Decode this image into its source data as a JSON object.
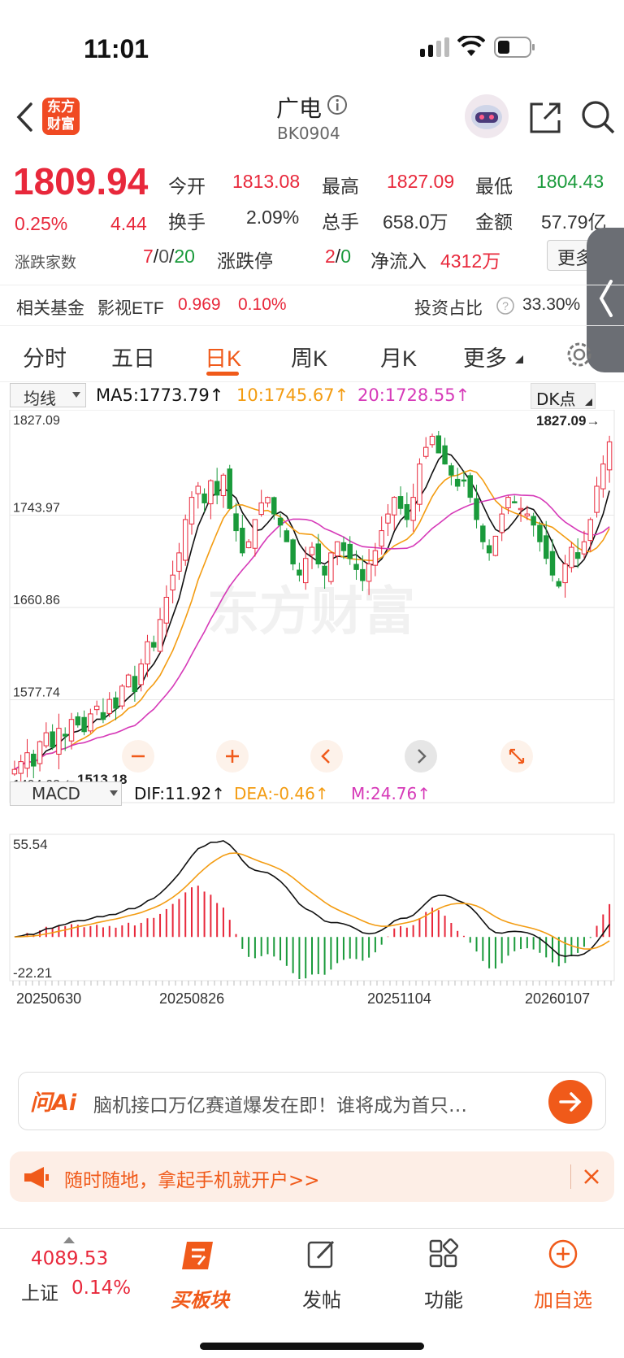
{
  "status": {
    "time": "11:01"
  },
  "header": {
    "logo_line1": "东方",
    "logo_line2": "财富",
    "title": "广电",
    "code": "BK0904"
  },
  "quote": {
    "price": "1809.94",
    "change_pct": "0.25%",
    "change": "4.44",
    "open_label": "今开",
    "open": "1813.08",
    "high_label": "最高",
    "high": "1827.09",
    "low_label": "最低",
    "low": "1804.43",
    "turnover_label": "换手",
    "turnover": "2.09%",
    "volume_label": "总手",
    "volume": "658.0万",
    "amount_label": "金额",
    "amount": "57.79亿",
    "breadth_label": "涨跌家数",
    "up": "7",
    "flat": "0",
    "down": "20",
    "limit_label": "涨跌停",
    "limit_up": "2",
    "limit_down": "0",
    "netflow_label": "净流入",
    "netflow": "4312万",
    "more": "更多"
  },
  "fund": {
    "label": "相关基金",
    "name": "影视ETF",
    "price": "0.969",
    "pct": "0.10%",
    "ratio_label": "投资占比",
    "ratio": "33.30%"
  },
  "tabs": [
    {
      "label": "分时"
    },
    {
      "label": "五日"
    },
    {
      "label": "日K"
    },
    {
      "label": "周K"
    },
    {
      "label": "月K"
    },
    {
      "label": "更多"
    }
  ],
  "chart_controls": {
    "ma_select": "均线",
    "ma5": "MA5:1773.79↑",
    "ma10": "10:1745.67↑",
    "ma20": "20:1728.55↑",
    "dk": "DK点",
    "macd_select": "MACD",
    "dif": "DIF:11.92↑",
    "dea": "DEA:-0.46↑",
    "m": "M:24.76↑",
    "watermark": "东方财富"
  },
  "chart_data": {
    "type": "candlestick",
    "y_ticks": [
      "1827.09",
      "1743.97",
      "1660.86",
      "1577.74",
      "1494.62"
    ],
    "ylim": [
      1494.62,
      1827.09
    ],
    "high_marker": "1827.09→",
    "low_marker": "←1513.18",
    "x_ticks": [
      "20250630",
      "20250826",
      "20251104",
      "20260107"
    ],
    "close": [
      1515,
      1522,
      1530,
      1518,
      1540,
      1548,
      1535,
      1552,
      1545,
      1560,
      1555,
      1549,
      1565,
      1572,
      1560,
      1578,
      1570,
      1590,
      1600,
      1585,
      1610,
      1630,
      1625,
      1650,
      1670,
      1690,
      1710,
      1740,
      1760,
      1770,
      1755,
      1775,
      1762,
      1780,
      1750,
      1730,
      1710,
      1720,
      1740,
      1755,
      1760,
      1745,
      1735,
      1720,
      1700,
      1690,
      1705,
      1715,
      1700,
      1690,
      1710,
      1720,
      1712,
      1705,
      1695,
      1685,
      1700,
      1712,
      1730,
      1745,
      1760,
      1750,
      1740,
      1760,
      1790,
      1805,
      1815,
      1800,
      1790,
      1780,
      1770,
      1775,
      1760,
      1740,
      1720,
      1710,
      1725,
      1745,
      1760,
      1755,
      1750,
      1745,
      1735,
      1720,
      1705,
      1690,
      1680,
      1700,
      1715,
      1705,
      1720,
      1740,
      1770,
      1790,
      1810
    ],
    "macd_labels": [
      "55.54",
      "-22.21"
    ],
    "dif_now": 11.92,
    "dea_now": -0.46,
    "m_now": 24.76,
    "series": [
      {
        "name": "MA5",
        "value": 1773.79,
        "color": "#111111"
      },
      {
        "name": "MA10",
        "value": 1745.67,
        "color": "#f39c12"
      },
      {
        "name": "MA20",
        "value": 1728.55,
        "color": "#d63ab8"
      }
    ]
  },
  "ai": {
    "brand": "问Ai",
    "text": "脑机接口万亿赛道爆发在即！谁将成为首只…"
  },
  "promo": {
    "text": "随时随地，拿起手机就开户>>"
  },
  "bottom": {
    "index_value": "4089.53",
    "index_name": "上证",
    "index_pct": "0.14%",
    "items": [
      {
        "label": "买板块"
      },
      {
        "label": "发帖"
      },
      {
        "label": "功能"
      },
      {
        "label": "加自选"
      }
    ]
  },
  "colors": {
    "up": "#e8283b",
    "down": "#1a9a3b",
    "accent": "#f05a1a"
  }
}
